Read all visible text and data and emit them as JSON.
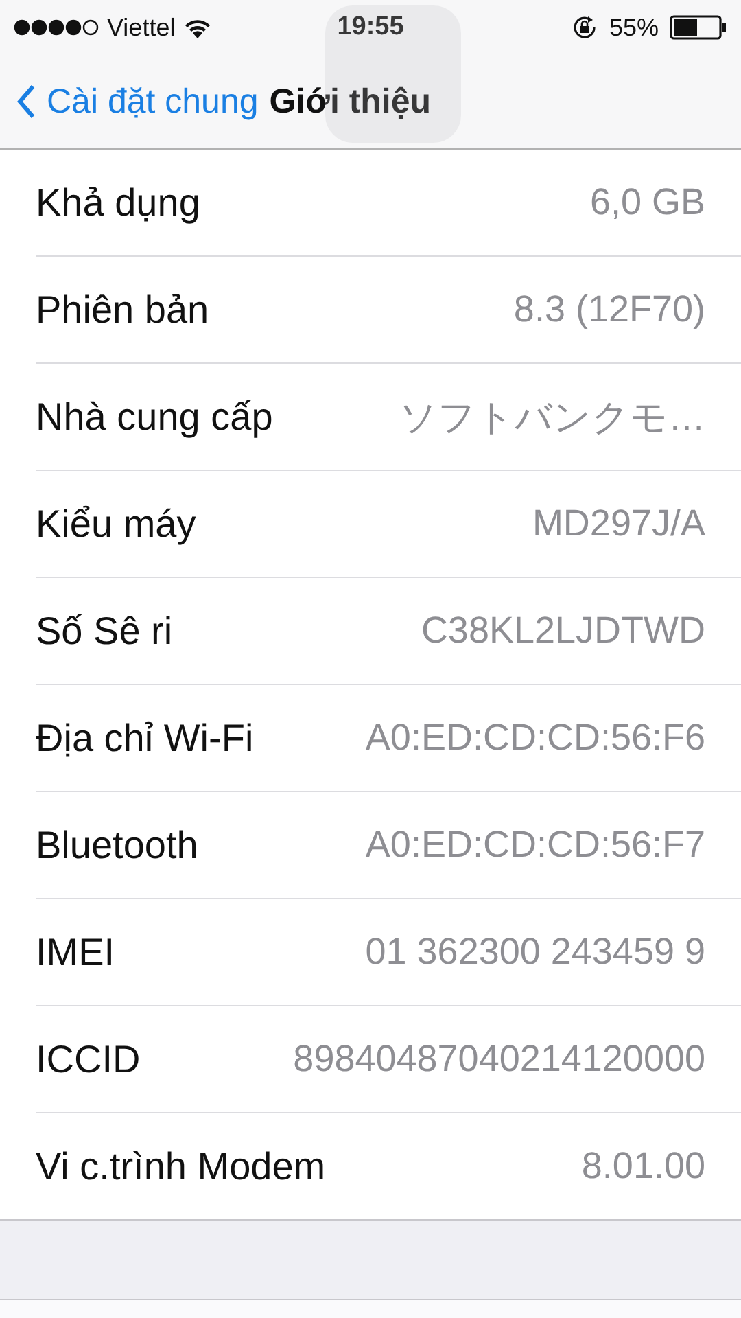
{
  "status_bar": {
    "carrier": "Viettel",
    "time": "19:55",
    "battery_percent": "55%"
  },
  "nav_bar": {
    "back_label": "Cài đặt chung",
    "title": "Giới thiệu"
  },
  "rows": [
    {
      "label": "Khả dụng",
      "value": "6,0 GB"
    },
    {
      "label": "Phiên bản",
      "value": "8.3 (12F70)"
    },
    {
      "label": "Nhà cung cấp",
      "value": "ソフトバンクモ…"
    },
    {
      "label": "Kiểu máy",
      "value": "MD297J/A"
    },
    {
      "label": "Số Sê ri",
      "value": "C38KL2LJDTWD"
    },
    {
      "label": "Địa chỉ Wi-Fi",
      "value": "A0:ED:CD:CD:56:F6"
    },
    {
      "label": "Bluetooth",
      "value": "A0:ED:CD:CD:56:F7"
    },
    {
      "label": "IMEI",
      "value": "01 362300 243459 9"
    },
    {
      "label": "ICCID",
      "value": "89840487040214120000"
    },
    {
      "label": "Vi c.trình Modem",
      "value": "8.01.00"
    }
  ]
}
